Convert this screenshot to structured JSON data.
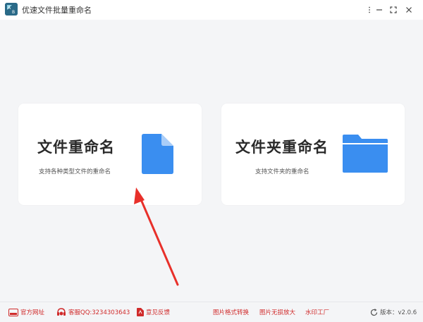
{
  "window": {
    "title": "优速文件批量重命名",
    "logo_text": "A B"
  },
  "cards": [
    {
      "title": "文件重命名",
      "subtitle": "支持各种类型文件的重命名",
      "icon": "file-icon"
    },
    {
      "title": "文件夹重命名",
      "subtitle": "支持文件夹的重命名",
      "icon": "folder-icon"
    }
  ],
  "footer": {
    "website": "官方网址",
    "support": "客服QQ:3234303643",
    "feedback": "意见反馈",
    "convert": "图片格式转换",
    "enlarge": "图片无损放大",
    "watermark": "水印工厂",
    "version": "版本：v2.0.6"
  },
  "colors": {
    "accent_blue": "#3a8ef0",
    "link_red": "#d02b2b",
    "annotation_arrow": "#e8302a"
  }
}
